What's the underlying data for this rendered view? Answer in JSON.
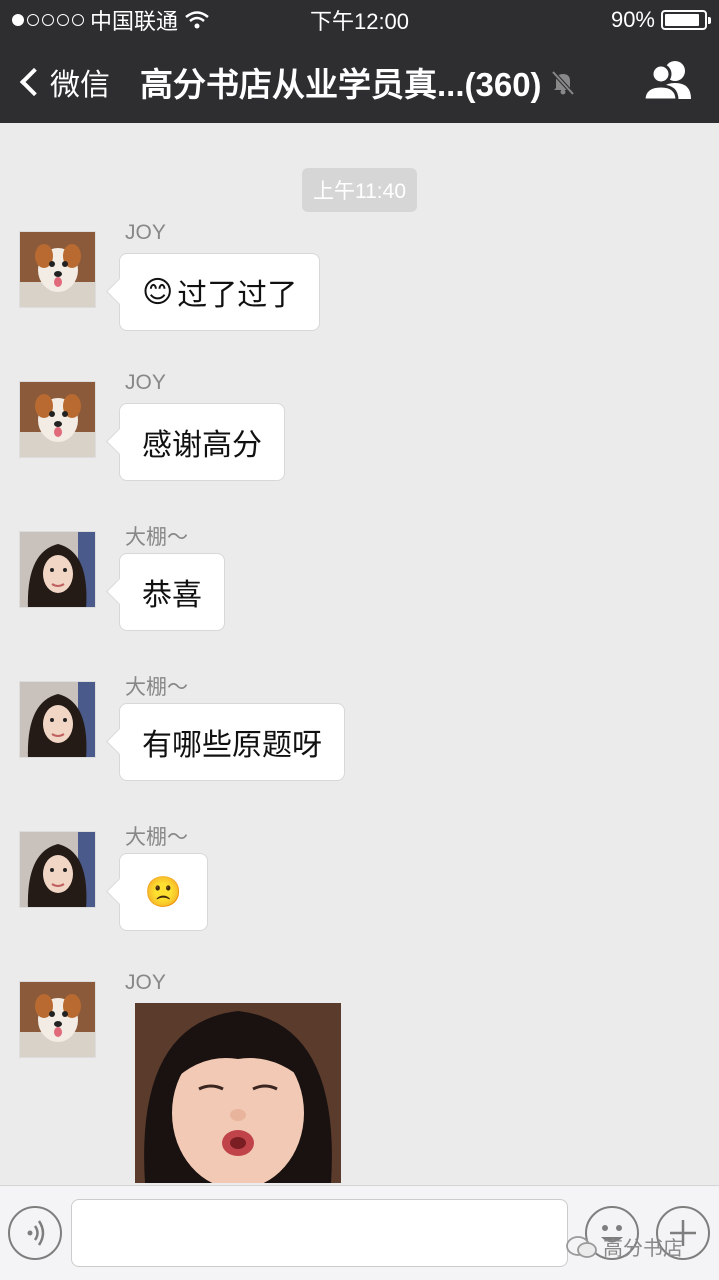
{
  "status_bar": {
    "carrier": "中国联通",
    "time": "下午12:00",
    "battery_percent": "90%",
    "battery_level": 0.9,
    "signal_dots_filled": 1
  },
  "nav": {
    "back_label": "微信",
    "title": "高分书店从业学员真...(360)"
  },
  "chat": {
    "timestamp": "上午11:40",
    "messages": [
      {
        "sender": "JOY",
        "text": "过了过了",
        "emoji": "😊",
        "avatar": "dog-avatar"
      },
      {
        "sender": "JOY",
        "text": "感谢高分",
        "avatar": "dog-avatar"
      },
      {
        "sender": "大棚～",
        "text": "恭喜",
        "avatar": "woman-avatar"
      },
      {
        "sender": "大棚～",
        "text": "有哪些原题呀",
        "avatar": "woman-avatar"
      },
      {
        "sender": "大棚～",
        "text": "",
        "emoji": "🙁",
        "avatar": "woman-avatar"
      },
      {
        "sender": "JOY",
        "image": "child-face-photo",
        "avatar": "dog-avatar"
      }
    ]
  },
  "input": {
    "voice_icon": "voice-icon",
    "emoji_icon": "smiley-icon",
    "plus_icon": "plus-icon"
  },
  "watermark": {
    "text": "高分书店"
  }
}
